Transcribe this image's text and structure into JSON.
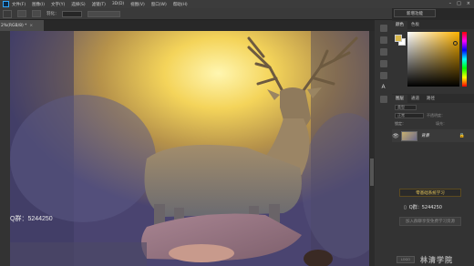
{
  "menubar": {
    "items": [
      "文件(F)",
      "图像(I)",
      "文字(Y)",
      "选择(S)",
      "滤镜(T)",
      "3D(D)",
      "视图(V)",
      "窗口(W)",
      "帮助(H)"
    ],
    "window_controls": [
      "–",
      "□",
      "×"
    ]
  },
  "options_bar": {
    "item1": "羽化："
  },
  "workspace": {
    "selected": "新增功能"
  },
  "document_tab": {
    "title": "2%(RGB/8) *",
    "close": "×"
  },
  "overlay": {
    "qq_text": "Q群：5244250"
  },
  "panels": {
    "color_tabs": [
      "颜色",
      "色板"
    ],
    "layers_tabs": [
      "图层",
      "通道",
      "路径"
    ],
    "filter_placeholder": "类型",
    "blend_mode": "正常",
    "opacity_label": "不透明度：",
    "fill_label": "填充：",
    "lock_label": "锁定：",
    "layer": {
      "name": "背景",
      "lock": "🔒",
      "eye": "👁"
    }
  },
  "promo": {
    "learn_button": "零基础系统学习",
    "qq_icon": "▯",
    "qq_text": "Q群：5244250",
    "join_button": "加入群聊享受免费学习资源"
  },
  "brand": {
    "logo_text": "LOGO",
    "name": "林清学院"
  },
  "colors": {
    "foreground": "#d9b84a",
    "background": "#ffffff",
    "accent_gold": "#e8c75a"
  }
}
